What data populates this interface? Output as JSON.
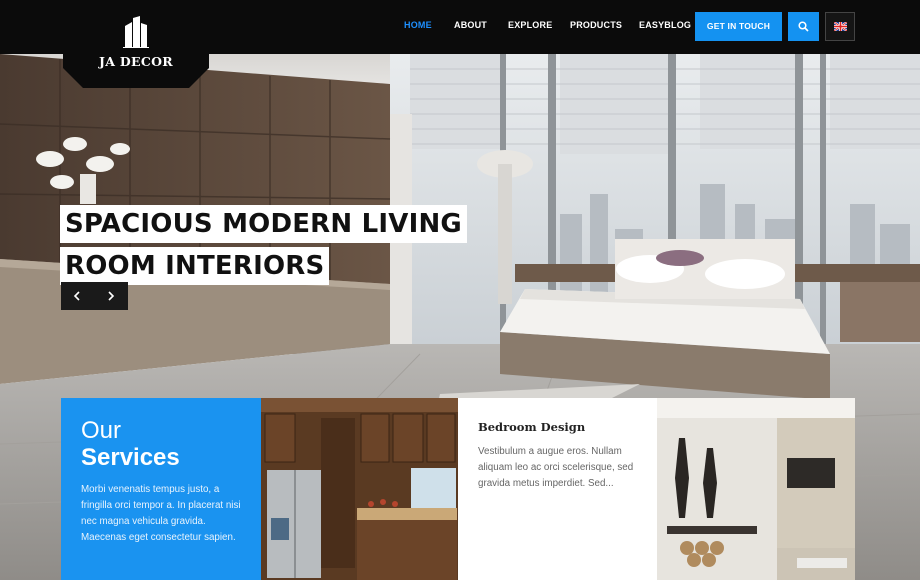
{
  "brand": {
    "name": "JA DECOR",
    "logo_icon": "building-icon"
  },
  "nav": {
    "items": [
      {
        "label": "HOME",
        "active": true
      },
      {
        "label": "ABOUT",
        "active": false
      },
      {
        "label": "EXPLORE",
        "active": false
      },
      {
        "label": "PRODUCTS",
        "active": false
      },
      {
        "label": "EASYBLOG",
        "active": false
      }
    ],
    "cta_label": "GET IN TOUCH",
    "search_icon": "search-icon",
    "language_icon": "uk-flag-icon"
  },
  "hero": {
    "headline_line1": "SPACIOUS MODERN LIVING",
    "headline_line2": "ROOM INTERIORS",
    "prev_icon": "chevron-left-icon",
    "next_icon": "chevron-right-icon"
  },
  "services": {
    "title_line1": "Our",
    "title_line2": "Services",
    "description": "Morbi venenatis tempus justo, a fringilla orci tempor a. In placerat nisi nec magna vehicula gravida. Maecenas eget consectetur sapien."
  },
  "bedroom": {
    "title": "Bedroom Design",
    "description": "Vestibulum a augue eros. Nullam aliquam leo ac orci scelerisque, sed gravida metus imperdiet. Sed..."
  },
  "colors": {
    "accent": "#1492f1",
    "header_bg": "#0b0b0b",
    "active_nav": "#1e90ff"
  }
}
